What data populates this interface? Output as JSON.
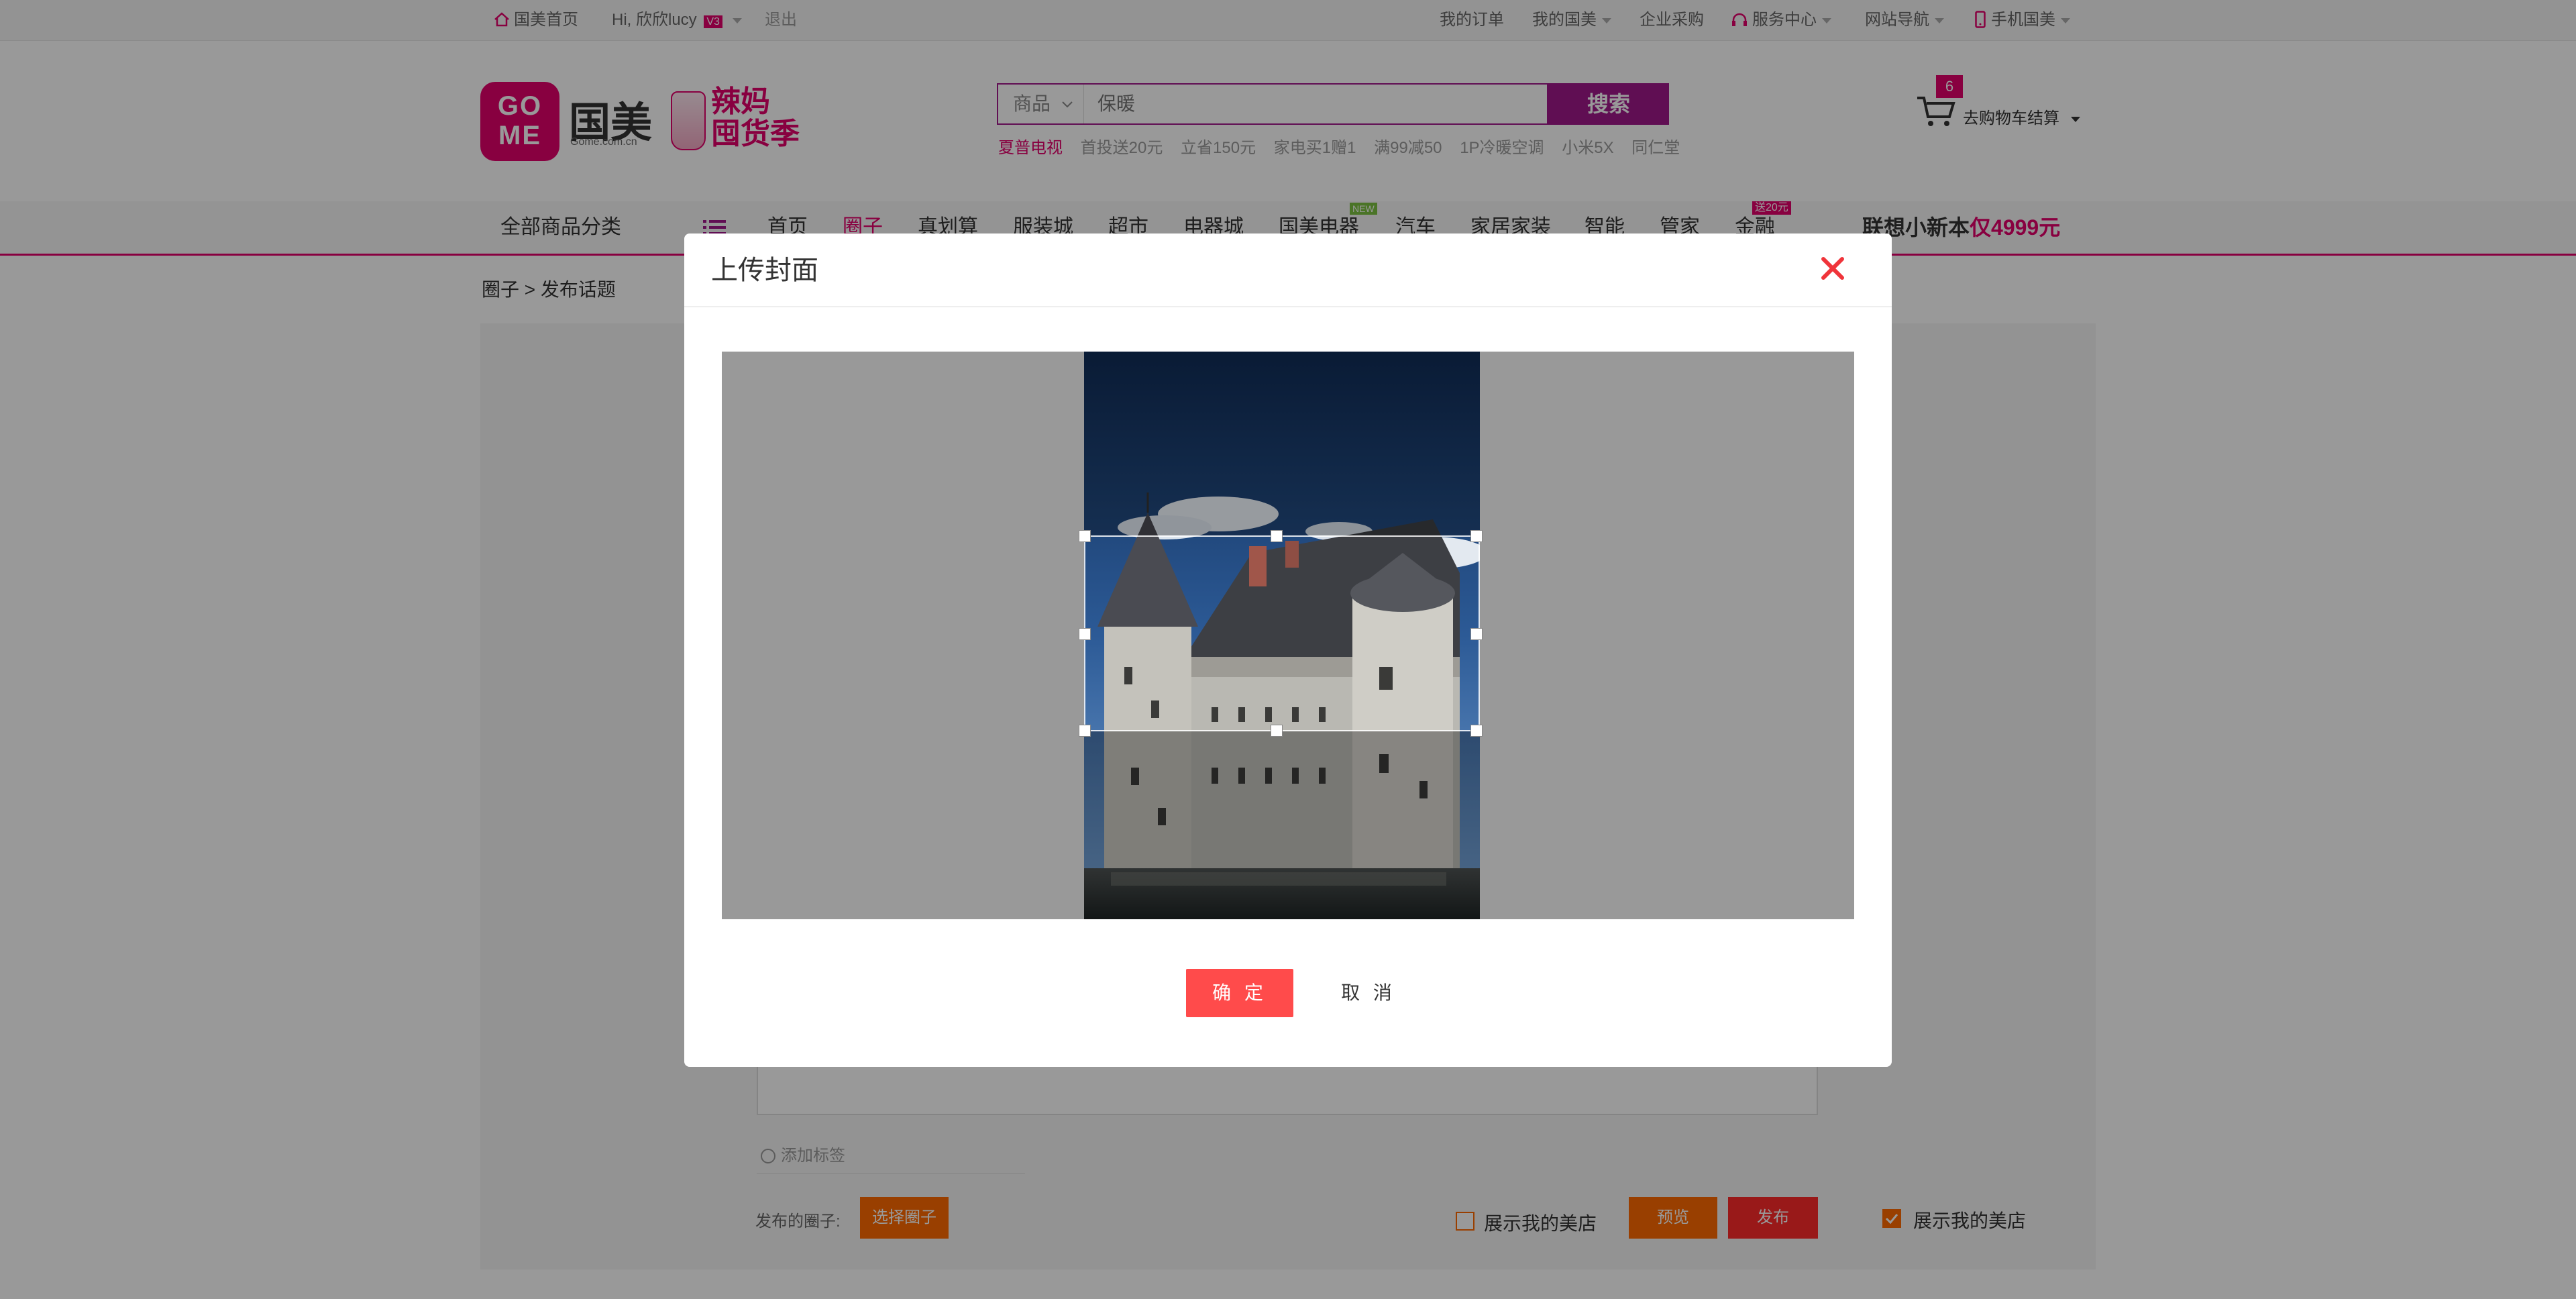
{
  "topbar": {
    "home": "国美首页",
    "greeting": "Hi, 欣欣lucy",
    "vip_badge": "V3",
    "logout": "退出",
    "orders": "我的订单",
    "my_gome": "我的国美",
    "enterprise": "企业采购",
    "service": "服务中心",
    "sitenav": "网站导航",
    "mobile": "手机国美"
  },
  "header": {
    "logo_text_top": "GO",
    "logo_text_bottom": "ME",
    "brand": "国美",
    "brand_sub": "Gome.com.cn",
    "promo_line1": "辣妈",
    "promo_line2": "囤货季"
  },
  "search": {
    "category": "商品",
    "placeholder": "保暖",
    "button": "搜索",
    "hotwords": [
      "夏普电视",
      "首投送20元",
      "立省150元",
      "家电买1赠1",
      "满99减50",
      "1P冷暖空调",
      "小米5X",
      "同仁堂"
    ]
  },
  "cart": {
    "count": "6",
    "label": "去购物车结算"
  },
  "nav": {
    "all_categories": "全部商品分类",
    "items": [
      "首页",
      "圈子",
      "真划算",
      "服装城",
      "超市",
      "电器城",
      "国美电器",
      "汽车",
      "家居家装",
      "智能",
      "管家",
      "金融"
    ],
    "active_index": 1,
    "badge_new": "NEW",
    "badge_finance": "送20元",
    "ad_prefix": "联想小新本",
    "ad_price": "仅4999元"
  },
  "breadcrumb": "圈子 > 发布话题",
  "form": {
    "add_tag": "添加标签",
    "publish_to": "发布的圈子:",
    "select_circle": "选择圈子",
    "show_store_1": "展示我的美店",
    "preview": "预览",
    "publish": "发布",
    "show_store_2": "展示我的美店",
    "show_store_2_checked": true
  },
  "modal": {
    "title": "上传封面",
    "confirm": "确 定",
    "cancel": "取 消"
  },
  "colors": {
    "brand_magenta": "#e3006b",
    "search_purple": "#a0188b",
    "confirm_red": "#ff4b4b",
    "orange": "#ff6a00"
  }
}
